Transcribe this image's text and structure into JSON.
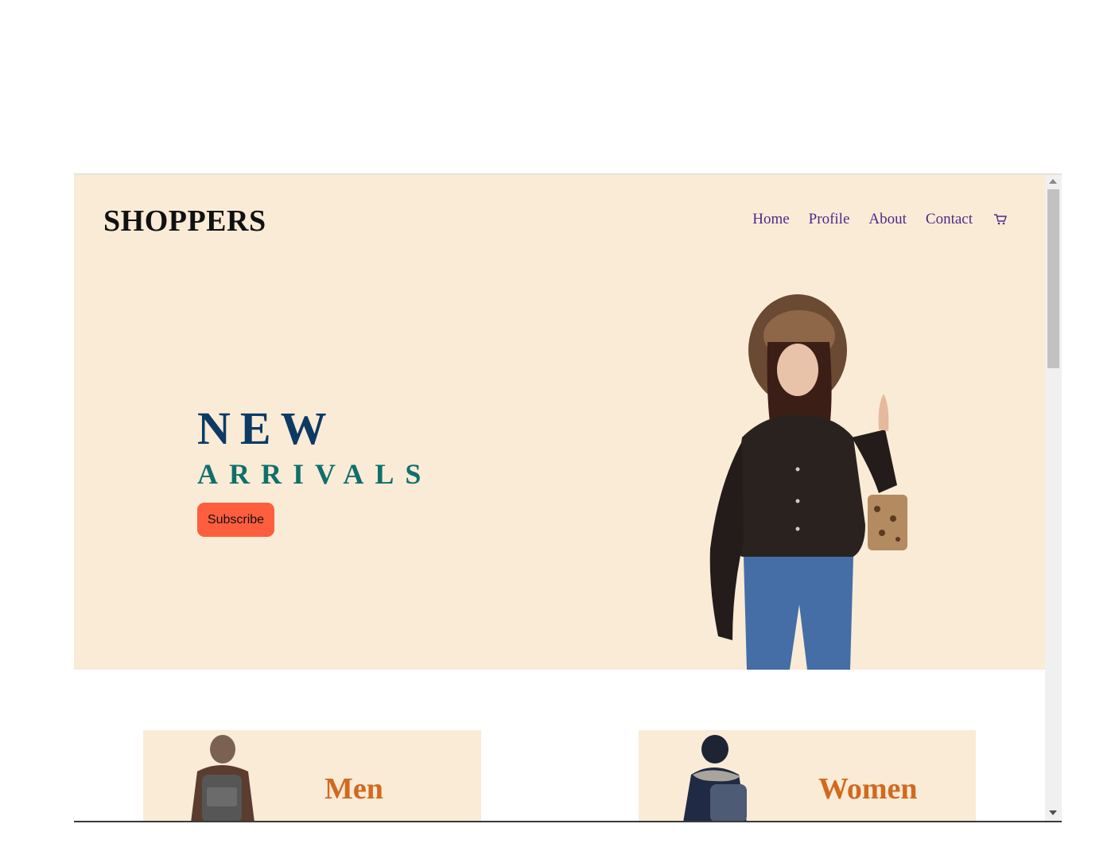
{
  "header": {
    "brand": "SHOPPERS",
    "nav": [
      "Home",
      "Profile",
      "About",
      "Contact"
    ],
    "cart_icon": "cart-icon"
  },
  "hero": {
    "line1": "NEW",
    "line2": "ARRIVALS",
    "cta_label": "Subscribe",
    "image_icon": "model-woman-image"
  },
  "categories": [
    {
      "label": "Men",
      "image": "man-with-backpack-image"
    },
    {
      "label": "Women",
      "image": "woman-with-backpack-image"
    }
  ],
  "colors": {
    "hero_bg": "#faebd7",
    "nav_link": "#4b2a8a",
    "headline_new": "#0d3a63",
    "headline_arrivals": "#0f6f6b",
    "cta_bg": "#ff5e3e",
    "category_label": "#d2691e"
  }
}
